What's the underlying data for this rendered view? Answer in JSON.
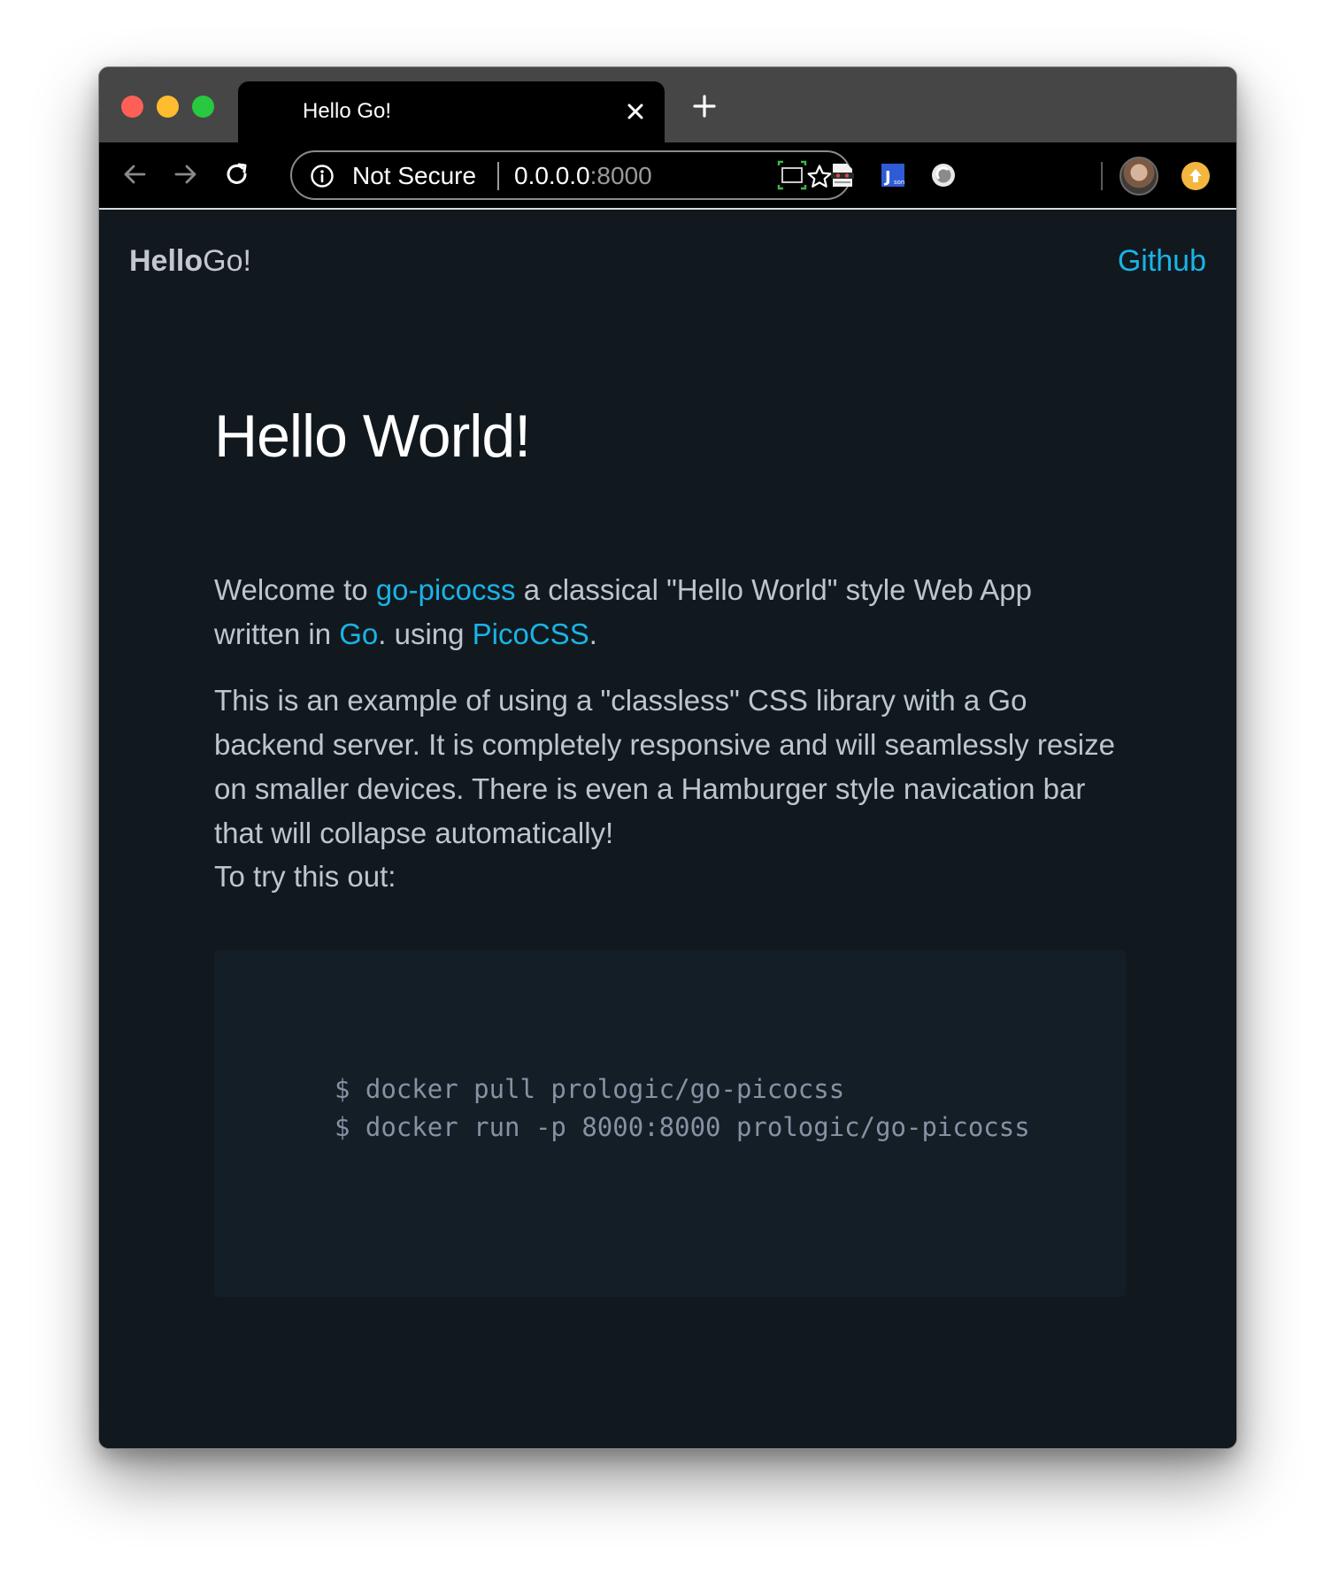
{
  "browser": {
    "tab": {
      "title": "Hello Go!"
    },
    "address_bar": {
      "security_label": "Not Secure",
      "host": "0.0.0.0",
      "port": ":8000"
    },
    "icons": {
      "back": "arrow-left-icon",
      "forward": "arrow-right-icon",
      "reload": "reload-icon",
      "info": "info-icon",
      "bookmark": "star-icon",
      "new_tab": "plus-icon",
      "close_tab": "close-icon"
    },
    "extensions": [
      "screenshot-extension-icon",
      "incognito-extension-icon",
      "json-extension-icon",
      "toggle-extension-icon"
    ],
    "colors": {
      "traffic_red": "#fe5f57",
      "traffic_yellow": "#febc2e",
      "traffic_green": "#28c840",
      "update": "#f3b63e"
    }
  },
  "site": {
    "brand": {
      "bold": "Hello",
      "regular": "Go!"
    },
    "nav": {
      "github": "Github"
    },
    "colors": {
      "background": "#11191f",
      "link": "#1ab3e6",
      "text": "#bbc6ce",
      "heading": "#ffffff",
      "code_background": "#141e26"
    }
  },
  "main": {
    "title": "Hello World!",
    "intro": {
      "t1": "Welcome to ",
      "link1": "go-picocss",
      "t2": " a classical \"Hello World\" style Web App written in ",
      "link2": "Go",
      "t3": ". using ",
      "link3": "PicoCSS",
      "t4": "."
    },
    "paragraph2": "This is an example of using a \"classless\" CSS library with a Go backend server. It is completely responsive and will seamlessly resize on smaller devices. There is even a Hamburger style navication bar that will collapse automatically!",
    "paragraph3": "To try this out:",
    "code": [
      "$ docker pull prologic/go-picocss",
      "$ docker run -p 8000:8000 prologic/go-picocss"
    ]
  }
}
